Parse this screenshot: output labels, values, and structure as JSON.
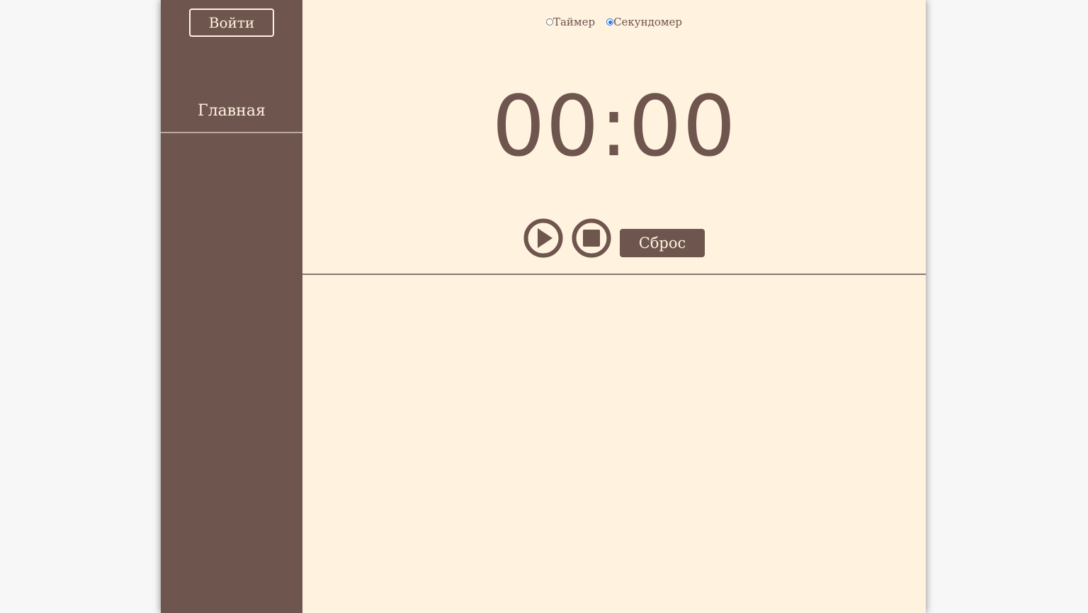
{
  "sidebar": {
    "login_label": "Войти",
    "nav": [
      {
        "label": "Главная"
      }
    ]
  },
  "mode_switch": {
    "options": [
      {
        "label": "Таймер",
        "checked": false
      },
      {
        "label": "Секундомер",
        "checked": true
      }
    ]
  },
  "display": {
    "time": "00:00"
  },
  "controls": {
    "play_icon": "play-icon",
    "stop_icon": "stop-icon",
    "reset_label": "Сброс"
  },
  "colors": {
    "brand": "#6e554d",
    "background": "#fff2df",
    "text_light": "#fff2e0",
    "radio_accent": "#1a73e8"
  }
}
